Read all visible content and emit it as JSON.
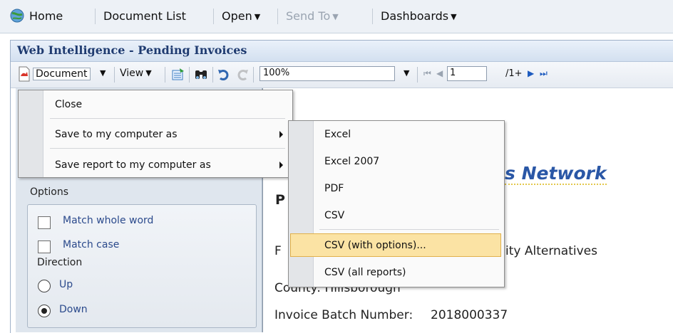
{
  "topnav": {
    "home": "Home",
    "document_list": "Document List",
    "open": "Open",
    "send_to": "Send To",
    "dashboards": "Dashboards"
  },
  "window": {
    "title": "Web Intelligence - Pending Invoices"
  },
  "toolbar": {
    "document": "Document",
    "view": "View",
    "zoom": "100%",
    "page": "1",
    "page_total": "/1+"
  },
  "document_menu": {
    "items": [
      "Close",
      "Save to my computer as",
      "Save report to my computer as"
    ]
  },
  "save_submenu": {
    "items": [
      "Excel",
      "Excel 2007",
      "PDF",
      "CSV",
      "CSV (with options)...",
      "CSV (all reports)"
    ],
    "highlighted": "CSV (with options)..."
  },
  "left_panel": {
    "options_label": "Options",
    "match_whole_word": "Match whole word",
    "match_case": "Match case",
    "direction_label": "Direction",
    "up": "Up",
    "down": "Down",
    "direction_selected": "Down"
  },
  "report": {
    "network_text": "s Network",
    "p_text": "P",
    "f_text": "F",
    "alternatives_text": "ity Alternatives",
    "county_text": "County: Hillsborough",
    "invoice_label": "Invoice Batch Number:",
    "invoice_value": "2018000337"
  },
  "colors": {
    "accent": "#2a57a6",
    "title": "#1f3b70",
    "highlight": "#fbe3a4",
    "option_text": "#2b4a8c"
  }
}
